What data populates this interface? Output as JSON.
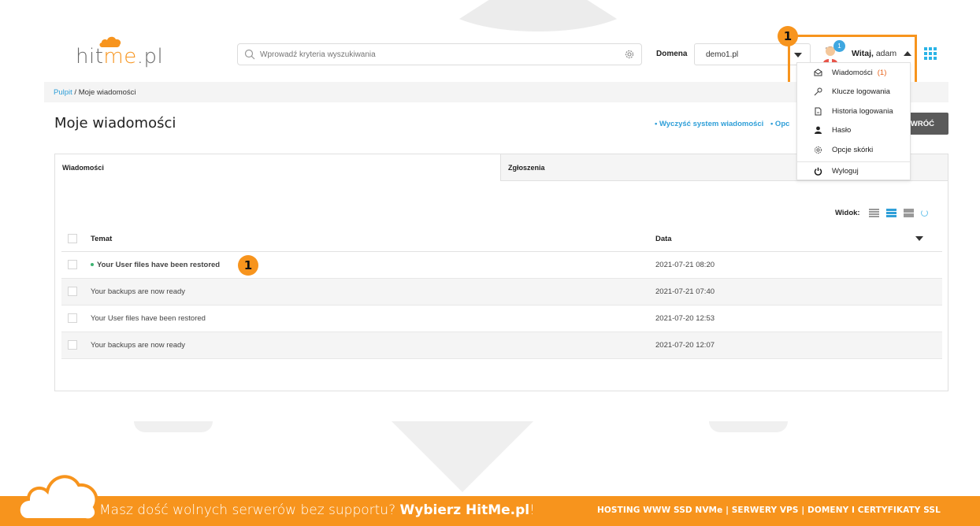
{
  "header": {
    "logo_text_a": "hit",
    "logo_text_me": "me",
    "logo_text_b": ".pl",
    "search_placeholder": "Wprowadź kryteria wyszukiwania",
    "domain_label": "Domena",
    "domain_value": "demo1.pl",
    "avatar_badge": "1",
    "greeting_bold": "Witaj,",
    "greeting_user": "adam",
    "step_badge": "1"
  },
  "breadcrumb": {
    "root": "Pulpit",
    "separator": " / ",
    "current": "Moje wiadomości"
  },
  "page": {
    "title": "Moje wiadomości",
    "link_clear": "• Wyczyść system wiadomości",
    "link_options": "• Opc",
    "back_label": "WRÓĆ"
  },
  "tabs": [
    "Wiadomości",
    "Zgłoszenia"
  ],
  "view": {
    "label": "Widok:"
  },
  "table": {
    "col_subject": "Temat",
    "col_date": "Data",
    "rows": [
      {
        "subject": "Your User files have been restored",
        "date": "2021-07-21 08:20",
        "unread": true
      },
      {
        "subject": "Your backups are now ready",
        "date": "2021-07-21 07:40",
        "unread": false
      },
      {
        "subject": "Your User files have been restored",
        "date": "2021-07-20 12:53",
        "unread": false
      },
      {
        "subject": "Your backups are now ready",
        "date": "2021-07-20 12:07",
        "unread": false
      }
    ],
    "row_badge": "1"
  },
  "menu": {
    "items": [
      {
        "label": "Wiadomości",
        "count": "(1)",
        "icon": "envelope-icon"
      },
      {
        "label": "Klucze logowania",
        "icon": "key-icon"
      },
      {
        "label": "Historia logowania",
        "icon": "history-icon"
      },
      {
        "label": "Hasło",
        "icon": "user-icon"
      },
      {
        "label": "Opcje skórki",
        "icon": "gear-icon"
      },
      {
        "label": "Wyloguj",
        "icon": "power-icon"
      }
    ]
  },
  "footer": {
    "text_a": "Masz dość wolnych serwerów bez supportu? ",
    "text_bold": "Wybierz HitMe.pl",
    "text_b": "!",
    "right": "HOSTING WWW SSD NVMe | SERWERY VPS | DOMENY I CERTYFIKATY SSL"
  },
  "colors": {
    "accent_orange": "#f7941d",
    "link_blue": "#2f9fd8",
    "unread_dot": "#3cb371"
  }
}
